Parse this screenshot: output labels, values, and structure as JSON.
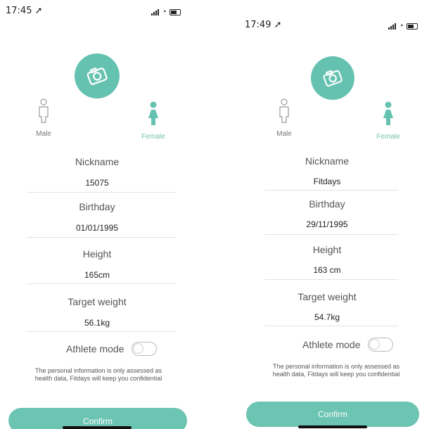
{
  "screens": [
    {
      "time": "17:45",
      "male_label": "Male",
      "female_label": "Female",
      "fields": [
        {
          "label": "Nickname",
          "value": "15075"
        },
        {
          "label": "Birthday",
          "value": "01/01/1995"
        },
        {
          "label": "Height",
          "value": "165cm"
        },
        {
          "label": "Target weight",
          "value": "56.1kg"
        }
      ],
      "athlete_label": "Athlete mode",
      "note_line1": "The personal information is only assessed as",
      "note_line2": "health data, Fitdays will keep you confidential",
      "confirm_label": "Confirm"
    },
    {
      "time": "17:49",
      "male_label": "Male",
      "female_label": "Female",
      "fields": [
        {
          "label": "Nickname",
          "value": "Fitdays"
        },
        {
          "label": "Birthday",
          "value": "29/11/1995"
        },
        {
          "label": "Height",
          "value": "163 cm"
        },
        {
          "label": "Target weight",
          "value": "54.7kg"
        }
      ],
      "athlete_label": "Athlete mode",
      "note_line1": "The personal information is only assessed as",
      "note_line2": "health data, Fitdays will keep you confidential",
      "confirm_label": "Confirm"
    }
  ],
  "colors": {
    "accent": "#66c2b0",
    "confirm": "#6cc4b2"
  },
  "icons": [
    "location-arrow-icon",
    "signal-icon",
    "wifi-icon",
    "battery-icon",
    "camera-icon",
    "male-icon",
    "female-icon"
  ]
}
